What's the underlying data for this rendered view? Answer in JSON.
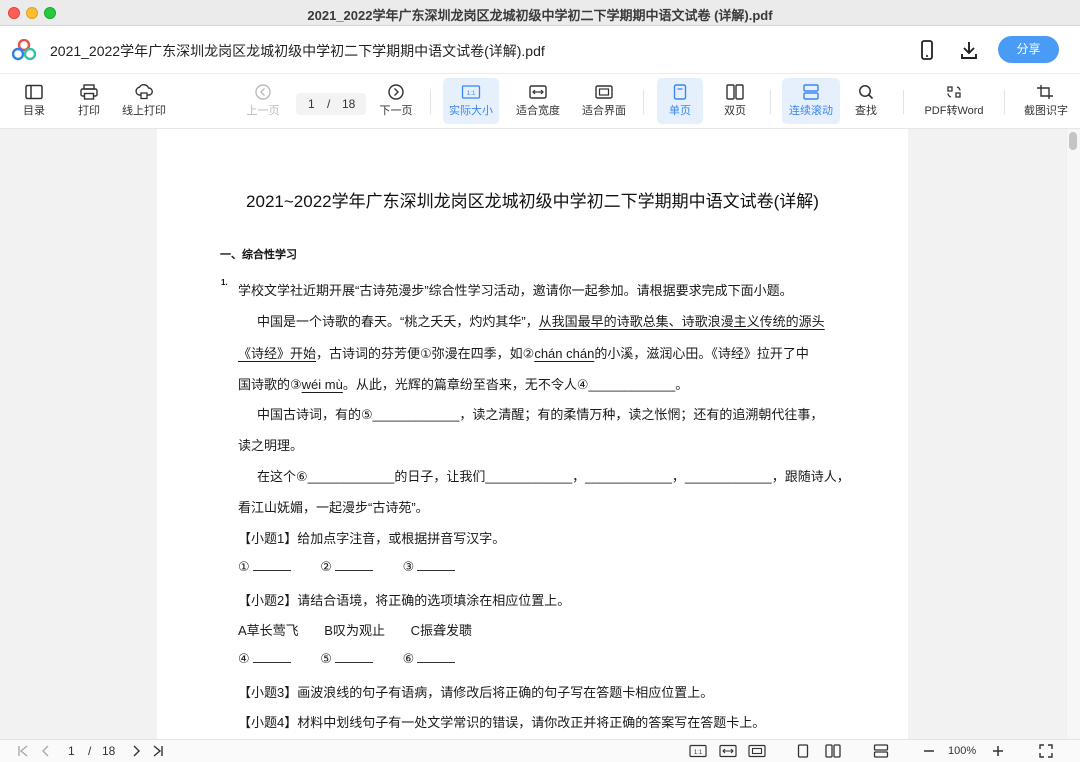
{
  "window": {
    "title": "2021_2022学年广东深圳龙岗区龙城初级中学初二下学期期中语文试卷 (详解).pdf"
  },
  "header": {
    "file_name": "2021_2022学年广东深圳龙岗区龙城初级中学初二下学期期中语文试卷(详解).pdf",
    "share_label": "分享"
  },
  "toolbar": {
    "toc": "目录",
    "print": "打印",
    "online_print": "线上打印",
    "prev_page": "上一页",
    "current_page": "1",
    "page_sep": "/",
    "total_pages": "18",
    "next_page": "下一页",
    "actual_size": "实际大小",
    "fit_width": "适合宽度",
    "fit_page": "适合界面",
    "single_page": "单页",
    "double_page": "双页",
    "continuous_scroll": "连续滚动",
    "find": "查找",
    "pdf_to_word": "PDF转Word",
    "ocr": "截图识字",
    "actual_size_icon_text": "1:1"
  },
  "document": {
    "title": "2021~2022学年广东深圳龙岗区龙城初级中学初二下学期期中语文试卷(详解)",
    "section": "一、综合性学习",
    "q_number": "1.",
    "lines": {
      "l1": "学校文学社近期开展“古诗苑漫步”综合性学习活动，邀请你一起参加。请根据要求完成下面小题。",
      "l2a": "中国是一个诗歌的春天。“桃之夭夭，灼灼其华”，",
      "l2b": "从我国最早的诗歌总集、诗歌浪漫主义传统的源头",
      "l3a": "《诗经》开始",
      "l3b": "，古诗词的芬芳便①弥漫在四季，如②",
      "l3c": "chán chán",
      "l3d": "的小溪，滋润心田。《诗经》拉开了中",
      "l4a": "国诗歌的③",
      "l4b": "wéi mù",
      "l4c": "。从此，光辉的篇章纷至沓来，无不令人④____________。",
      "l5": "中国古诗词，有的⑤____________，读之清醒；有的柔情万种，读之怅惘；还有的追溯朝代往事，",
      "l6": "读之明理。",
      "l7": "在这个⑥____________的日子，让我们____________，____________，____________，跟随诗人，",
      "l8": "看江山妩媚，一起漫步“古诗苑”。",
      "l9": "【小题1】给加点字注音，或根据拼音写汉字。",
      "l10_1": "①",
      "l10_2": "②",
      "l10_3": "③",
      "l11": "【小题2】请结合语境，将正确的选项填涂在相应位置上。",
      "l12_a": "A草长莺飞",
      "l12_b": "B叹为观止",
      "l12_c": "C振聋发聩",
      "l13_4": "④",
      "l13_5": "⑤",
      "l13_6": "⑥",
      "l14": "【小题3】画波浪线的句子有语病，请修改后将正确的句子写在答题卡相应位置上。",
      "l15": "【小题4】材料中划线句子有一处文学常识的错误，请你改正并将正确的答案写在答题卡上。"
    }
  },
  "statusbar": {
    "current_page": "1",
    "page_sep": "/",
    "total_pages": "18",
    "zoom": "100%",
    "actual_size_icon_text": "1:1"
  },
  "colors": {
    "accent": "#4a9bf5",
    "active_bg": "#e6f0fd",
    "active_text": "#3b86f0"
  }
}
